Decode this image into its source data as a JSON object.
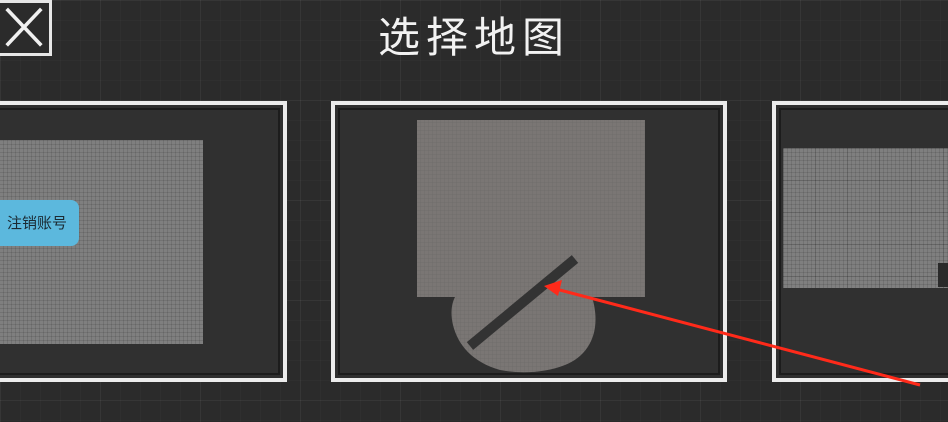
{
  "header": {
    "title": "选择地图",
    "close_icon": "close-icon"
  },
  "maps": [
    {
      "id": "left",
      "overlay_button_label": "注销账号",
      "floor_color": "#7f7f7f"
    },
    {
      "id": "middle",
      "floor_color": "#7a7674",
      "wall_color": "#333333"
    },
    {
      "id": "right",
      "floor_color": "#7f7f7f"
    }
  ],
  "colors": {
    "background": "#2b2b2b",
    "card_border": "#ececec",
    "bubble": "#5cb8dd",
    "annotation_arrow": "#ff2a1a"
  }
}
